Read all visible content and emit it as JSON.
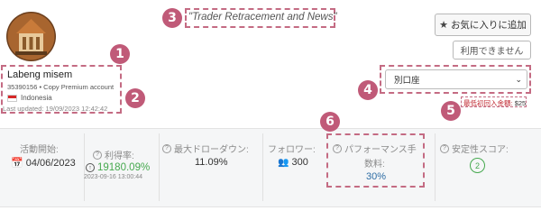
{
  "strategy_title": "\"Trader Retracement and News\"",
  "buttons": {
    "favorite": "お気に入りに追加",
    "unavailable": "利用できません"
  },
  "account": {
    "name": "Labeng misem",
    "meta": "35390156 • Copy Premium account",
    "country": "Indonesia",
    "last_updated": "Last updated: 19/09/2023 12:42:42"
  },
  "account_select": {
    "selected": "別口座"
  },
  "min_deposit": {
    "label": "最低初回入金額:",
    "value": "$25"
  },
  "badges": [
    "1",
    "2",
    "3",
    "4",
    "5",
    "6"
  ],
  "stats": {
    "active_since": {
      "label": "活動開始:",
      "value": "04/06/2023"
    },
    "yield": {
      "label": "利得率:",
      "value": "19180.09%",
      "date": "2023-09-16 13:00:44"
    },
    "max_drawdown": {
      "label": "最大ドローダウン:",
      "value": "11.09%"
    },
    "followers": {
      "label": "フォロワー:",
      "value": "300"
    },
    "performance_fee": {
      "label_line1": "パフォーマンス手",
      "label_line2": "数料:",
      "value": "30%"
    },
    "safety_score": {
      "label": "安定性スコア:",
      "value": "2"
    }
  },
  "colors": {
    "annotation": "#c05a78",
    "positive": "#46a94f",
    "warning": "#c0262e"
  }
}
